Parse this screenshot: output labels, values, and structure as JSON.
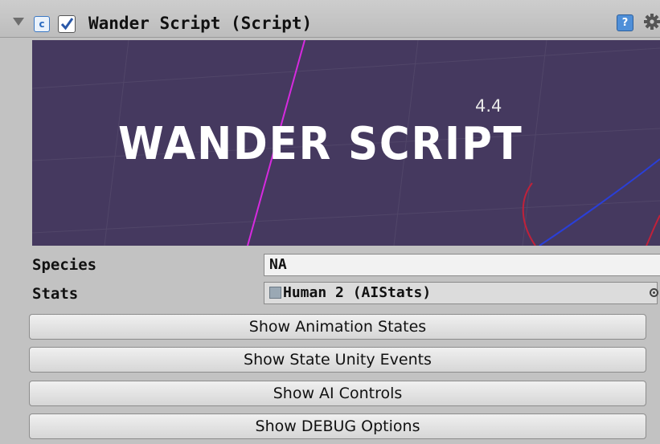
{
  "component": {
    "title": "Wander Script (Script)",
    "enabled": true,
    "icons": [
      "foldout-arrow-icon",
      "csharp-script-icon",
      "enable-checkbox",
      "help-icon",
      "gear-icon"
    ]
  },
  "banner": {
    "title": "WANDER SCRIPT",
    "version": "4.4",
    "colors": {
      "background": "#45395f",
      "magenta_line": "#d62adf",
      "red_circle": "#c0213a",
      "blue_curve": "#2a3fd8"
    }
  },
  "fields": {
    "species": {
      "label": "Species",
      "value": "NA"
    },
    "stats": {
      "label": "Stats",
      "value": "Human 2 (AIStats)"
    }
  },
  "buttons": {
    "animation_states": "Show Animation States",
    "state_unity_events": "Show State Unity Events",
    "ai_controls": "Show AI Controls",
    "debug_options": "Show DEBUG Options"
  }
}
